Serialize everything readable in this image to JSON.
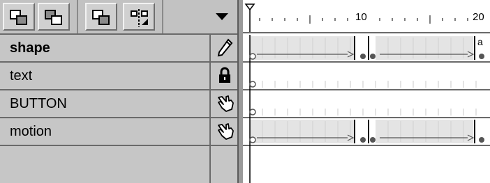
{
  "layers": [
    {
      "name": "shape",
      "bold": true,
      "status_icon": "pencil-icon"
    },
    {
      "name": "text",
      "bold": false,
      "status_icon": "lock-icon"
    },
    {
      "name": "BUTTON",
      "bold": false,
      "status_icon": "hand-icon"
    },
    {
      "name": "motion",
      "bold": false,
      "status_icon": "hand-icon"
    }
  ],
  "toolbar": {
    "buttons": [
      "layer-stack-icon",
      "layer-stack-icon",
      "layer-stack-icon",
      "align-icon"
    ],
    "menu_icon": "dropdown-arrow-icon"
  },
  "ruler": {
    "labels": [
      "10",
      "20"
    ]
  },
  "keyframe_label": "a"
}
